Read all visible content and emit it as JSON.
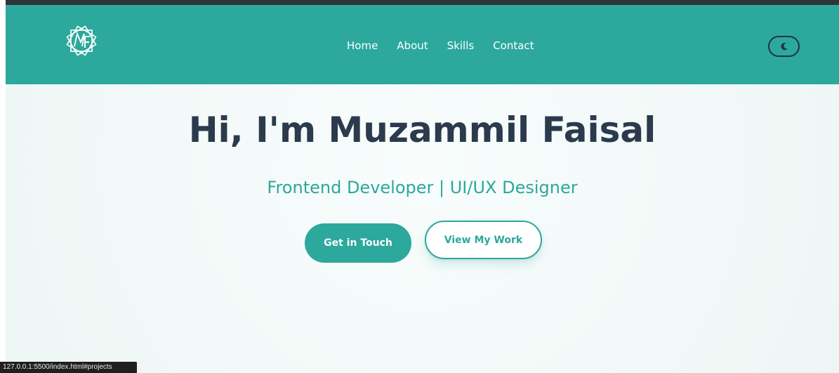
{
  "navbar": {
    "logo_icon": "mf-monogram-logo",
    "links": [
      {
        "label": "Home"
      },
      {
        "label": "About"
      },
      {
        "label": "Skills"
      },
      {
        "label": "Contact"
      }
    ],
    "theme_toggle_icon": "moon-icon"
  },
  "hero": {
    "title": "Hi, I'm Muzammil Faisal",
    "subtitle": "Frontend Developer | UI/UX Designer",
    "primary_button": "Get in Touch",
    "secondary_button": "View My Work"
  },
  "status_bar": {
    "url": "127.0.0.1:5500/index.html#projects"
  },
  "colors": {
    "accent": "#2ca89d",
    "heading": "#2b3a4d",
    "background": "#f2f9f8"
  }
}
